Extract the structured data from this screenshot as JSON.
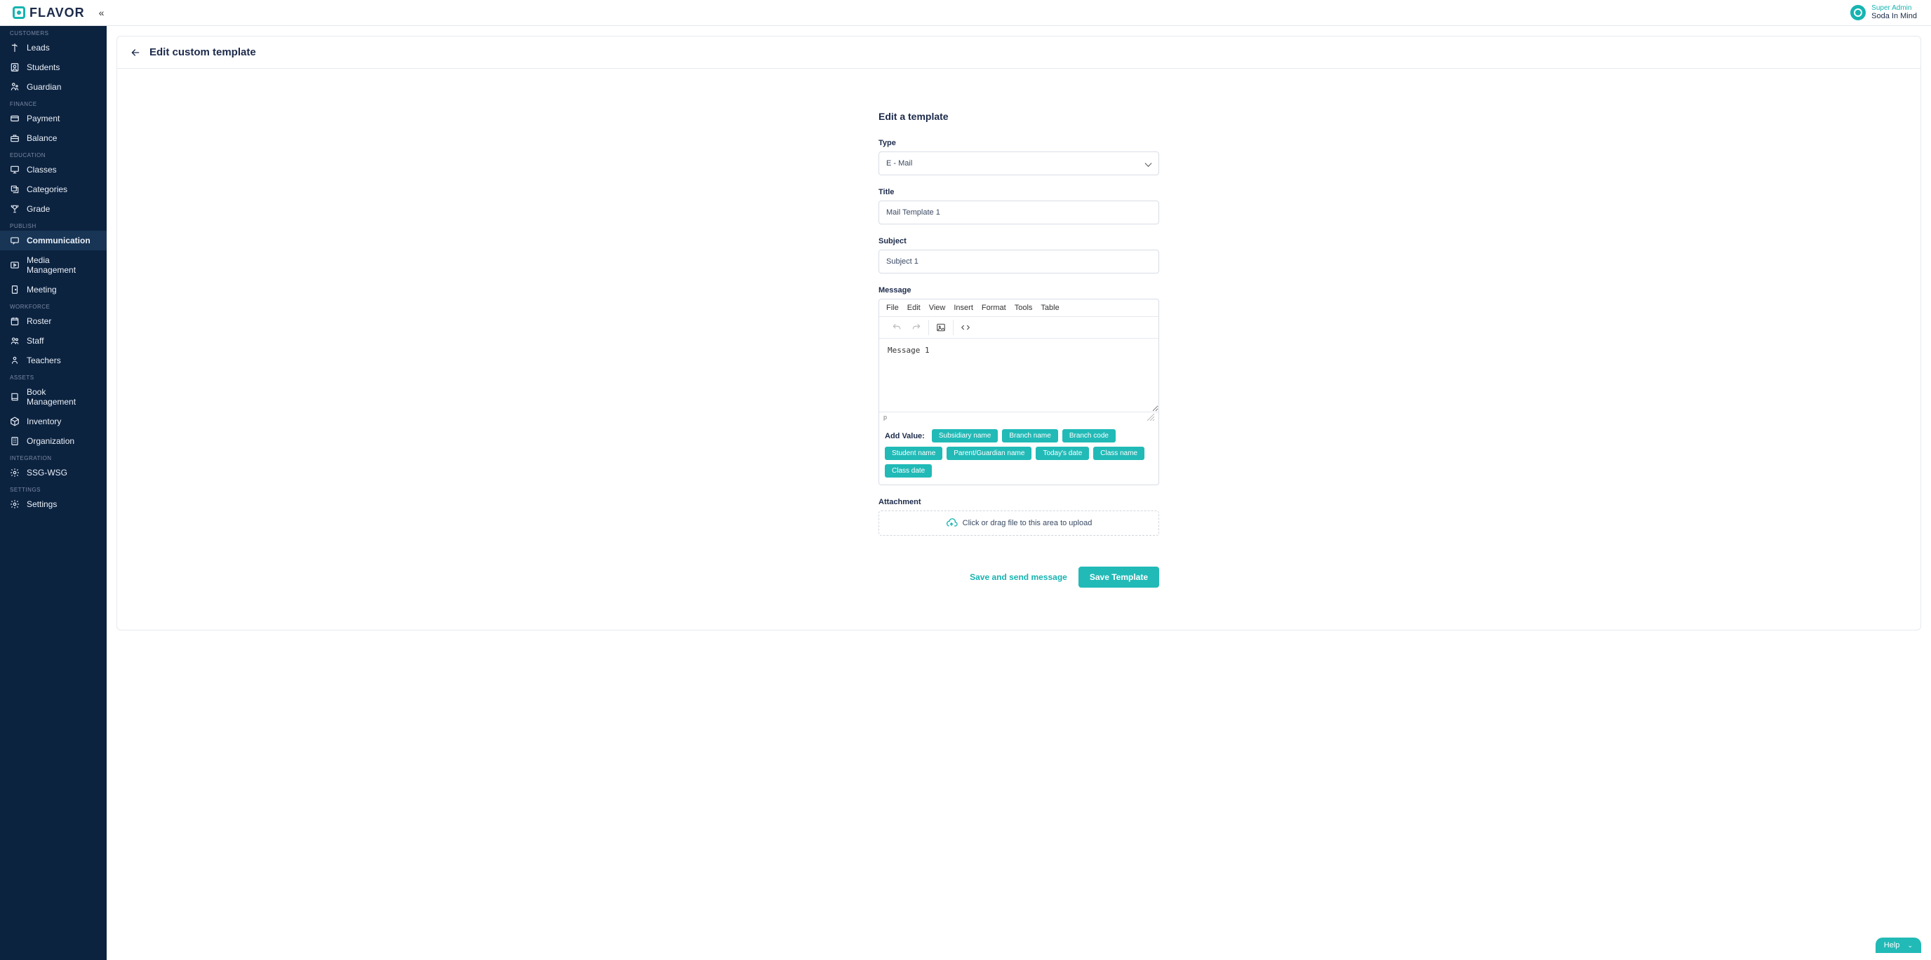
{
  "brand": {
    "name": "FLAVOR"
  },
  "user": {
    "role": "Super Admin",
    "org": "Soda In Mind"
  },
  "sidebar": {
    "groups": [
      {
        "title": "CUSTOMERS",
        "items": [
          {
            "label": "Leads",
            "icon": "signpost-icon"
          },
          {
            "label": "Students",
            "icon": "user-square-icon"
          },
          {
            "label": "Guardian",
            "icon": "guardian-icon"
          }
        ]
      },
      {
        "title": "FINANCE",
        "items": [
          {
            "label": "Payment",
            "icon": "card-icon"
          },
          {
            "label": "Balance",
            "icon": "briefcase-icon"
          }
        ]
      },
      {
        "title": "EDUCATION",
        "items": [
          {
            "label": "Classes",
            "icon": "presentation-icon"
          },
          {
            "label": "Categories",
            "icon": "stack-icon"
          },
          {
            "label": "Grade",
            "icon": "trophy-icon"
          }
        ]
      },
      {
        "title": "PUBLISH",
        "items": [
          {
            "label": "Communication",
            "icon": "chat-icon",
            "active": true
          },
          {
            "label": "Media Management",
            "icon": "media-icon"
          },
          {
            "label": "Meeting",
            "icon": "door-icon"
          }
        ]
      },
      {
        "title": "WORKFORCE",
        "items": [
          {
            "label": "Roster",
            "icon": "calendar-icon"
          },
          {
            "label": "Staff",
            "icon": "people-icon"
          },
          {
            "label": "Teachers",
            "icon": "teacher-icon"
          }
        ]
      },
      {
        "title": "ASSETS",
        "items": [
          {
            "label": "Book Management",
            "icon": "book-icon"
          },
          {
            "label": "Inventory",
            "icon": "box-icon"
          },
          {
            "label": "Organization",
            "icon": "building-icon"
          }
        ]
      },
      {
        "title": "INTEGRATION",
        "items": [
          {
            "label": "SSG-WSG",
            "icon": "gear-icon"
          }
        ]
      },
      {
        "title": "SETTINGS",
        "items": [
          {
            "label": "Settings",
            "icon": "gear-icon"
          }
        ]
      }
    ]
  },
  "page": {
    "title": "Edit custom template"
  },
  "form": {
    "heading": "Edit a template",
    "type_label": "Type",
    "type_value": "E - Mail",
    "title_label": "Title",
    "title_value": "Mail Template 1",
    "subject_label": "Subject",
    "subject_value": "Subject 1",
    "message_label": "Message",
    "editor_menu": [
      "File",
      "Edit",
      "View",
      "Insert",
      "Format",
      "Tools",
      "Table"
    ],
    "message_value": "Message 1",
    "editor_path": "p",
    "add_value_label": "Add Value:",
    "chips": [
      "Subsidiary name",
      "Branch name",
      "Branch code",
      "Student name",
      "Parent/Guardian name",
      "Today's date",
      "Class name",
      "Class date"
    ],
    "attachment_label": "Attachment",
    "upload_text": "Click or drag file to this area to upload",
    "actions": {
      "save_send": "Save and send message",
      "save": "Save Template"
    }
  },
  "help": {
    "label": "Help"
  }
}
